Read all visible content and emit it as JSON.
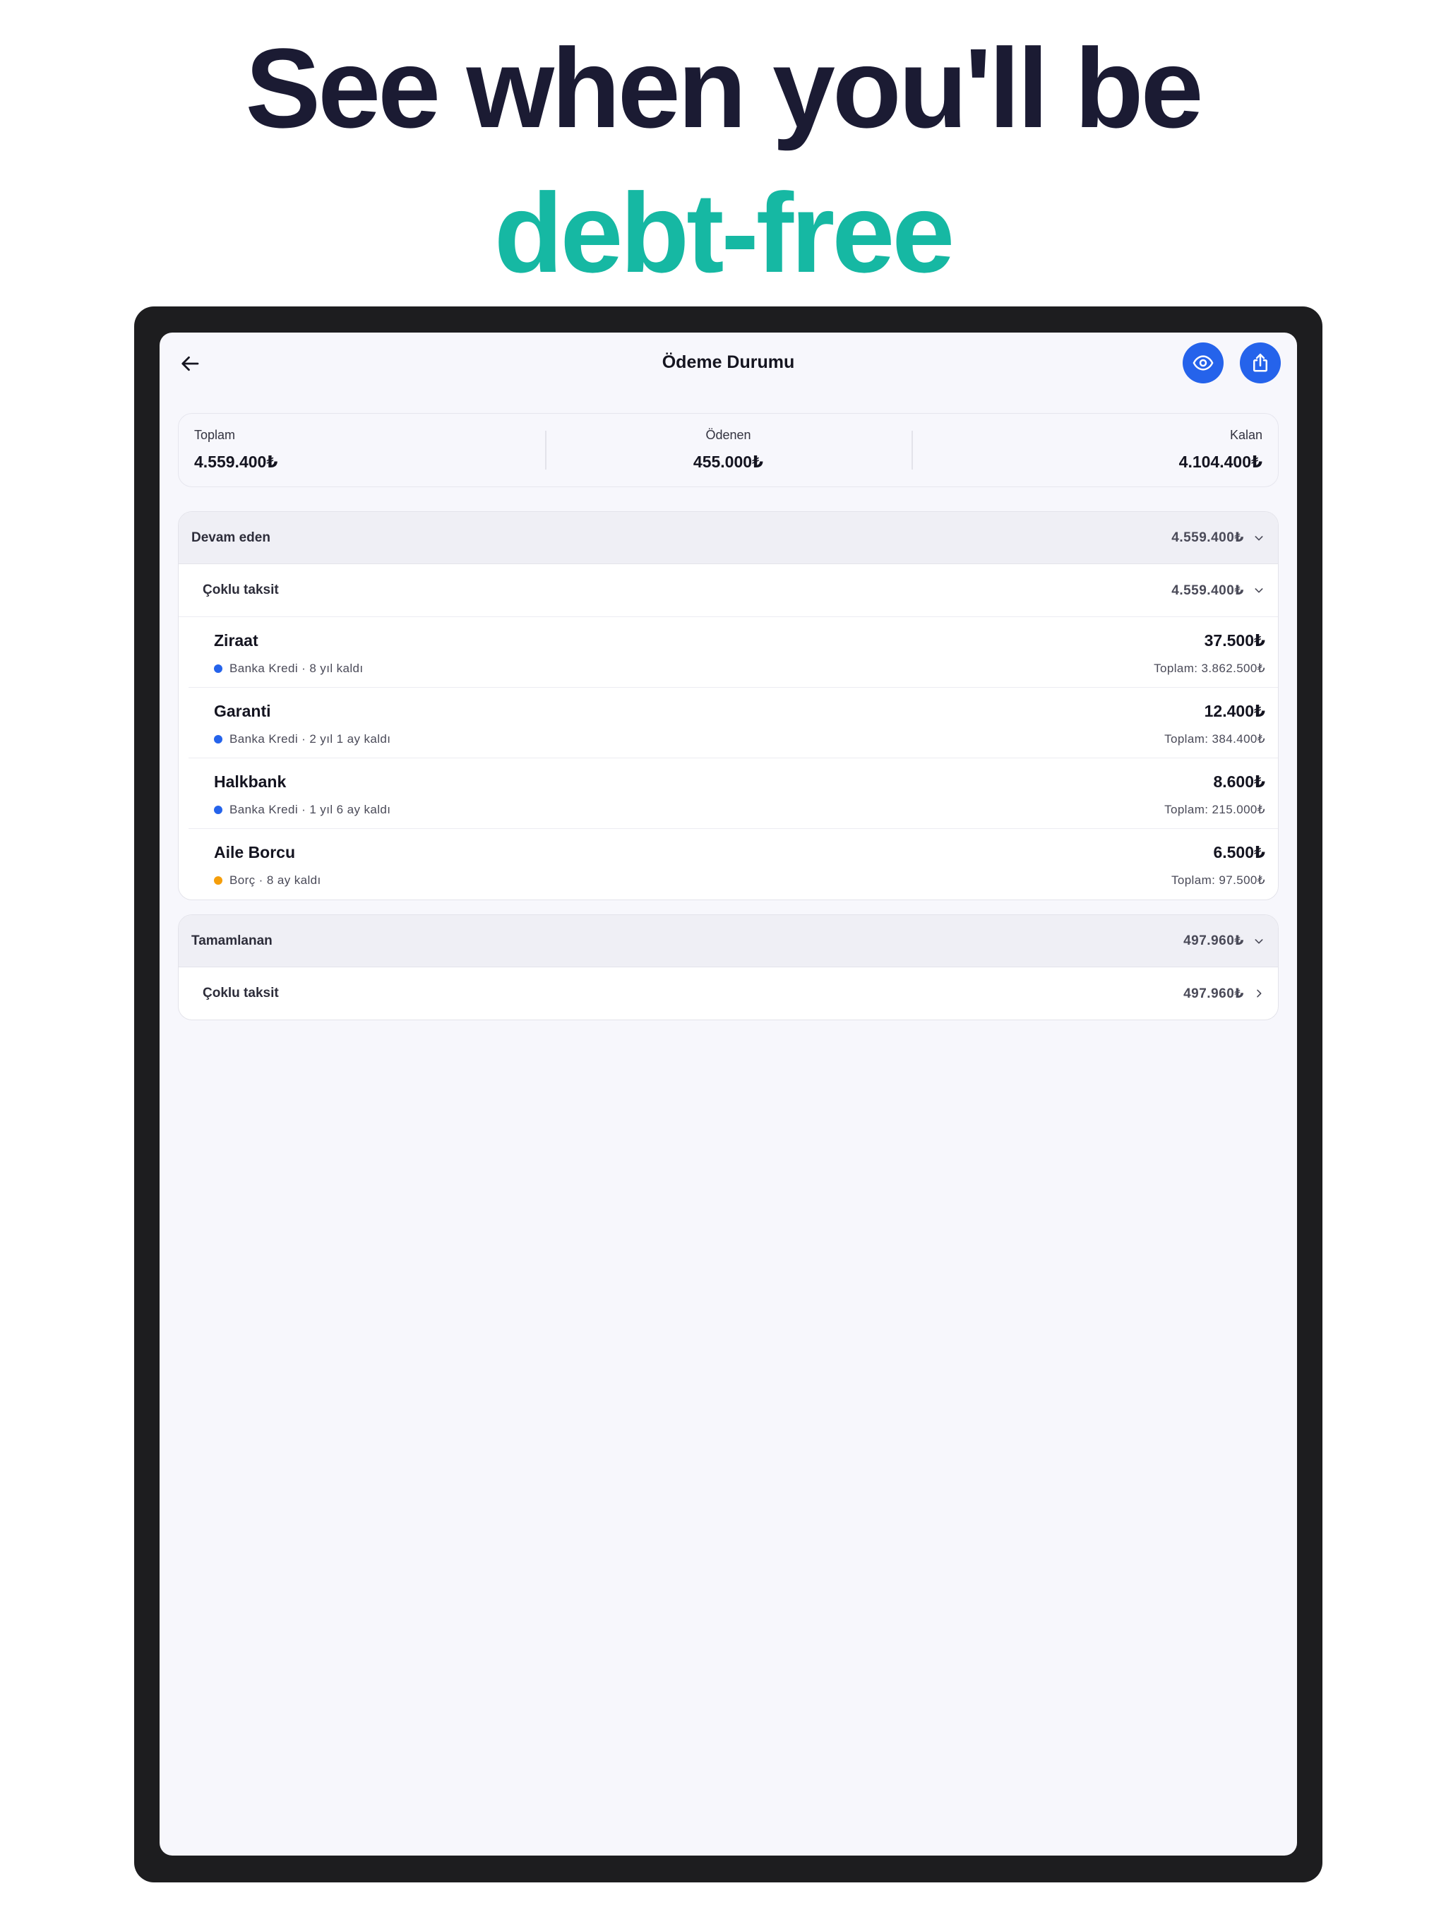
{
  "headline": {
    "line1": "See when you'll be",
    "line2": "debt-free"
  },
  "colors": {
    "accent_teal": "#16b8a3",
    "primary_blue": "#2563eb",
    "bank_dot": "#2563eb",
    "debt_dot": "#f59e0b"
  },
  "nav": {
    "back_icon": "arrow-left-icon",
    "title": "Ödeme Durumu",
    "eye_icon": "eye-icon",
    "share_icon": "share-icon"
  },
  "summary": {
    "total_label": "Toplam",
    "total_value": "4.559.400₺",
    "paid_label": "Ödenen",
    "paid_value": "455.000₺",
    "remaining_label": "Kalan",
    "remaining_value": "4.104.400₺"
  },
  "active_group": {
    "label": "Devam eden",
    "amount": "4.559.400₺",
    "chevron_icon": "chevron-down-icon",
    "subgroup": {
      "label": "Çoklu taksit",
      "amount": "4.559.400₺",
      "chevron_icon": "chevron-down-icon"
    },
    "items": [
      {
        "name": "Ziraat",
        "meta": "Banka Kredi · 8 yıl kaldı",
        "value": "37.500₺",
        "total": "Toplam: 3.862.500₺",
        "dot": "bank"
      },
      {
        "name": "Garanti",
        "meta": "Banka Kredi · 2 yıl 1 ay kaldı",
        "value": "12.400₺",
        "total": "Toplam: 384.400₺",
        "dot": "bank"
      },
      {
        "name": "Halkbank",
        "meta": "Banka Kredi · 1 yıl 6 ay kaldı",
        "value": "8.600₺",
        "total": "Toplam: 215.000₺",
        "dot": "bank"
      },
      {
        "name": "Aile Borcu",
        "meta": "Borç · 8 ay kaldı",
        "value": "6.500₺",
        "total": "Toplam: 97.500₺",
        "dot": "debt"
      }
    ]
  },
  "completed_group": {
    "label": "Tamamlanan",
    "amount": "497.960₺",
    "chevron_icon": "chevron-down-icon",
    "row": {
      "label": "Çoklu taksit",
      "amount": "497.960₺",
      "chevron_icon": "chevron-right-icon"
    }
  }
}
